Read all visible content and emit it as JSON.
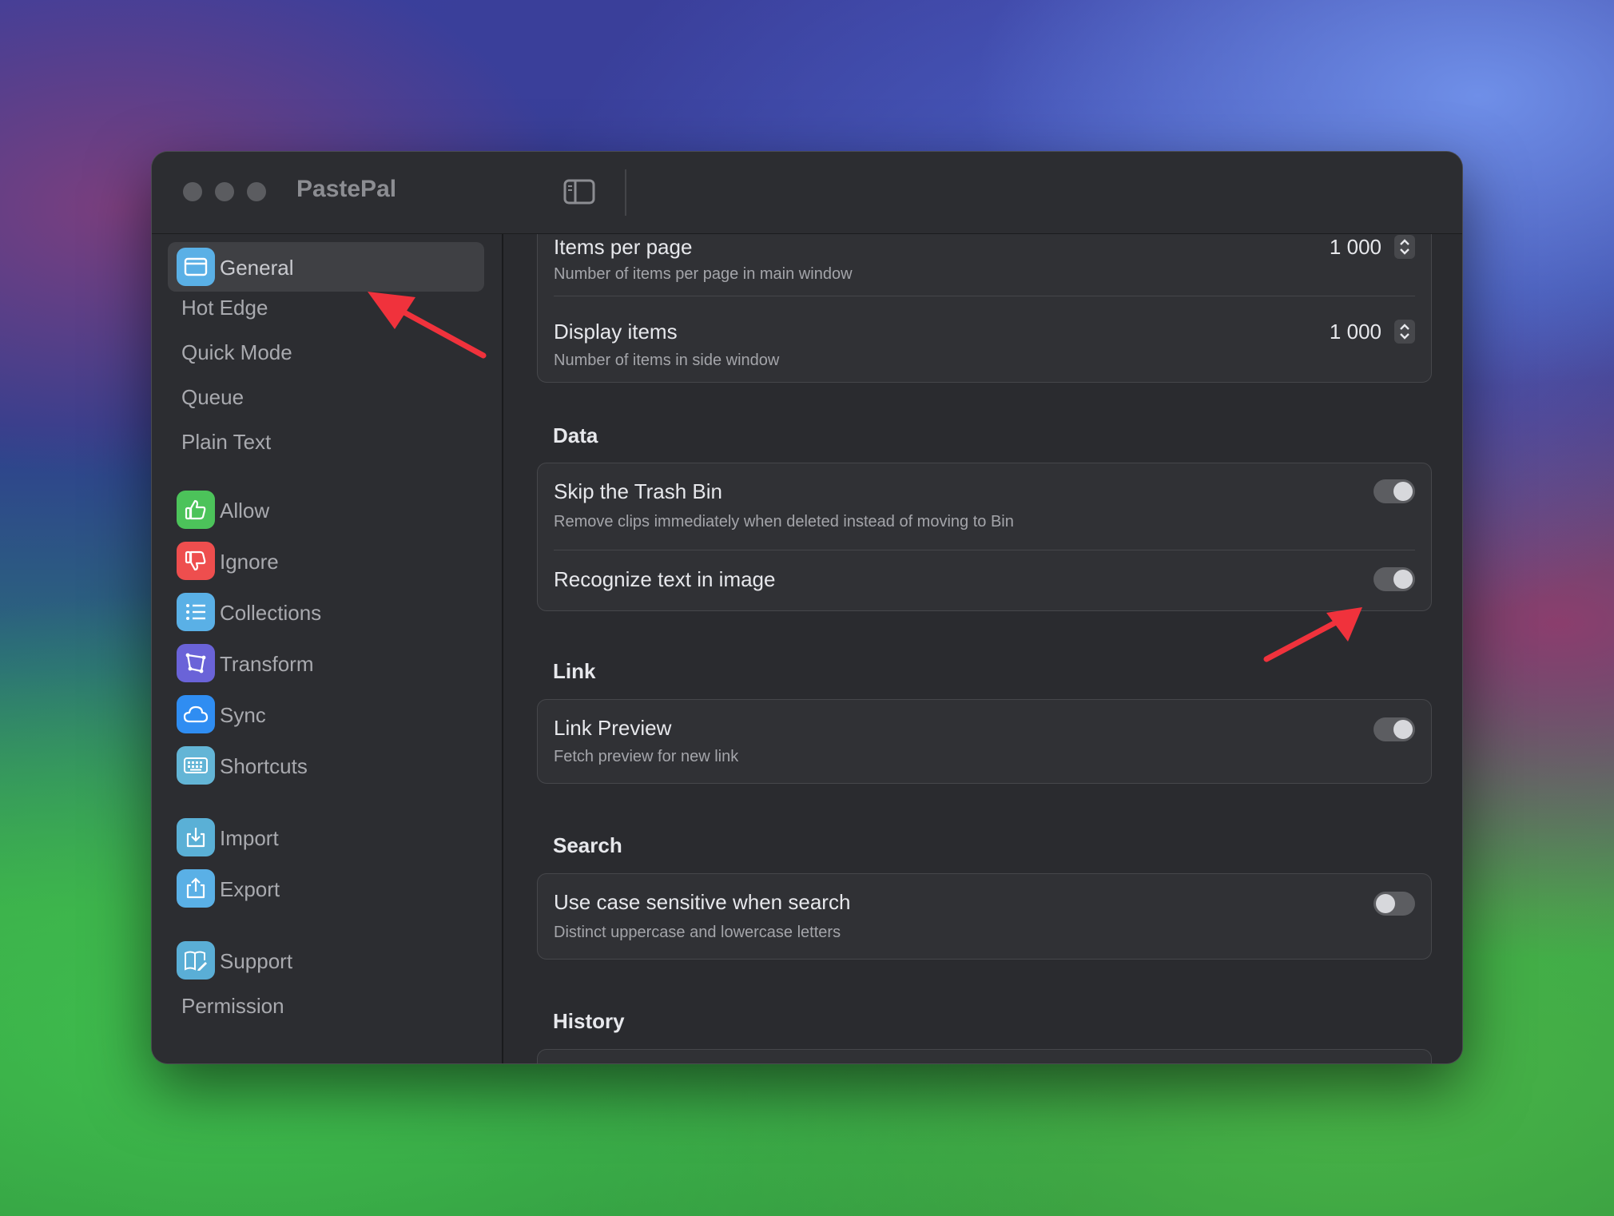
{
  "window": {
    "title": "PastePal"
  },
  "sidebar": {
    "groups": [
      {
        "id": "general",
        "label": "General",
        "icon": "window-icon",
        "color": "#5ab0e6",
        "selected": true
      },
      {
        "id": "hot-edge",
        "label": "Hot Edge"
      },
      {
        "id": "quick-mode",
        "label": "Quick Mode"
      },
      {
        "id": "queue",
        "label": "Queue"
      },
      {
        "id": "plain-text",
        "label": "Plain Text"
      },
      {
        "id": "allow",
        "label": "Allow",
        "icon": "thumbs-up-icon",
        "color": "#4cc35a"
      },
      {
        "id": "ignore",
        "label": "Ignore",
        "icon": "thumbs-down-icon",
        "color": "#ee4e4e"
      },
      {
        "id": "collections",
        "label": "Collections",
        "icon": "list-icon",
        "color": "#5ab0e6"
      },
      {
        "id": "transform",
        "label": "Transform",
        "icon": "transform-icon",
        "color": "#6a63d8"
      },
      {
        "id": "sync",
        "label": "Sync",
        "icon": "cloud-icon",
        "color": "#2f8df2"
      },
      {
        "id": "shortcuts",
        "label": "Shortcuts",
        "icon": "keyboard-icon",
        "color": "#63b5d6"
      },
      {
        "id": "import",
        "label": "Import",
        "icon": "import-icon",
        "color": "#5ab0d6"
      },
      {
        "id": "export",
        "label": "Export",
        "icon": "export-icon",
        "color": "#5ab0e6"
      },
      {
        "id": "support",
        "label": "Support",
        "icon": "support-icon",
        "color": "#5aaed6"
      },
      {
        "id": "permission",
        "label": "Permission"
      }
    ]
  },
  "content": {
    "display_card": {
      "items_per_page": {
        "title": "Items per page",
        "subtitle": "Number of items per page in main window",
        "value": "1 000"
      },
      "display_items": {
        "title": "Display items",
        "subtitle": "Number of items in side window",
        "value": "1 000"
      }
    },
    "data": {
      "header": "Data",
      "skip_trash": {
        "title": "Skip the Trash Bin",
        "subtitle": "Remove clips immediately when deleted instead of moving to Bin",
        "on": true
      },
      "recognize_text": {
        "title": "Recognize text in image",
        "on": true
      }
    },
    "link": {
      "header": "Link",
      "link_preview": {
        "title": "Link Preview",
        "subtitle": "Fetch preview for new link",
        "on": true
      }
    },
    "search": {
      "header": "Search",
      "case_sensitive": {
        "title": "Use case sensitive when search",
        "subtitle": "Distinct uppercase and lowercase letters",
        "on": false
      }
    },
    "history": {
      "header": "History"
    }
  },
  "annotations": {
    "arrow_color": "#f0323c"
  }
}
